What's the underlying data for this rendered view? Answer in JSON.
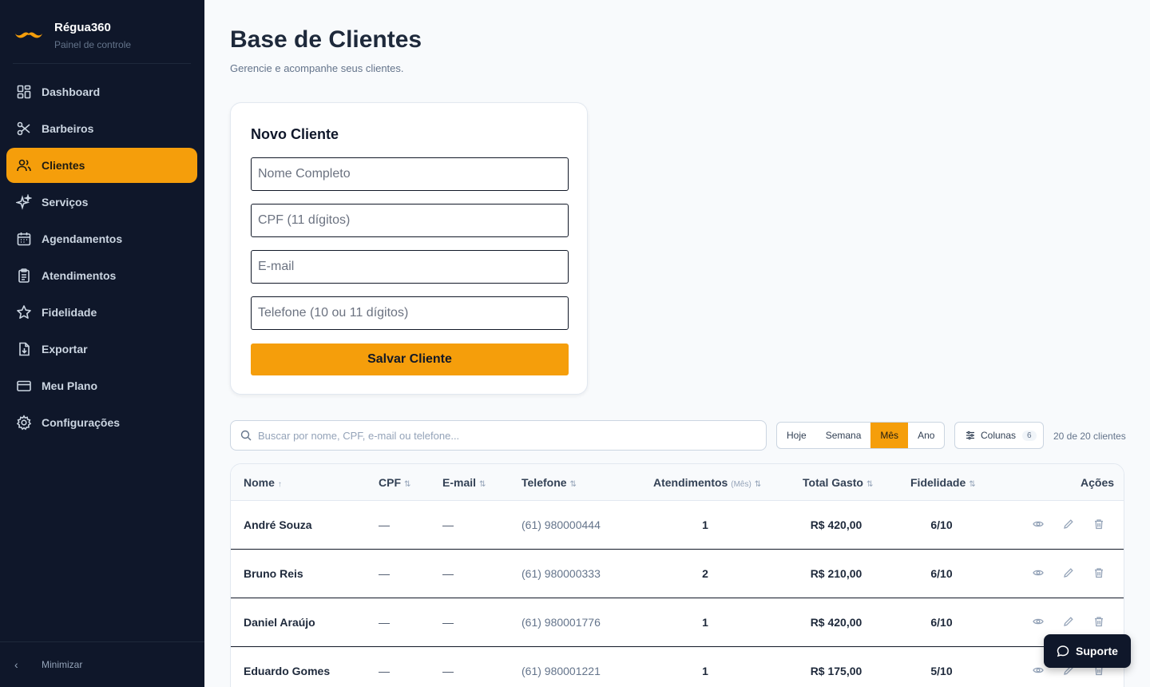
{
  "brand": {
    "name": "Régua360",
    "subtitle": "Painel de controle"
  },
  "sidebar": {
    "items": [
      {
        "label": "Dashboard",
        "icon": "grid-icon",
        "active": false
      },
      {
        "label": "Barbeiros",
        "icon": "scissors-icon",
        "active": false
      },
      {
        "label": "Clientes",
        "icon": "users-icon",
        "active": true
      },
      {
        "label": "Serviços",
        "icon": "sparkles-icon",
        "active": false
      },
      {
        "label": "Agendamentos",
        "icon": "calendar-icon",
        "active": false
      },
      {
        "label": "Atendimentos",
        "icon": "clipboard-icon",
        "active": false
      },
      {
        "label": "Fidelidade",
        "icon": "star-icon",
        "active": false
      },
      {
        "label": "Exportar",
        "icon": "file-download-icon",
        "active": false
      },
      {
        "label": "Meu Plano",
        "icon": "credit-card-icon",
        "active": false
      },
      {
        "label": "Configurações",
        "icon": "gear-icon",
        "active": false
      }
    ],
    "minimize_label": "Minimizar"
  },
  "page": {
    "title": "Base de Clientes",
    "subtitle": "Gerencie e acompanhe seus clientes."
  },
  "form": {
    "title": "Novo Cliente",
    "name_placeholder": "Nome Completo",
    "cpf_placeholder": "CPF (11 dígitos)",
    "email_placeholder": "E-mail",
    "phone_placeholder": "Telefone (10 ou 11 dígitos)",
    "save_label": "Salvar Cliente"
  },
  "toolbar": {
    "search_placeholder": "Buscar por nome, CPF, e-mail ou telefone...",
    "periods": [
      "Hoje",
      "Semana",
      "Mês",
      "Ano"
    ],
    "active_period": "Mês",
    "columns_label": "Colunas",
    "columns_count": "6",
    "count_text": "20 de 20 clientes"
  },
  "table": {
    "headers": {
      "name": "Nome",
      "name_sort": "↑",
      "cpf": "CPF",
      "email": "E-mail",
      "phone": "Telefone",
      "attendances": "Atendimentos",
      "attendances_sub": "(Mês)",
      "total": "Total Gasto",
      "loyalty": "Fidelidade",
      "actions": "Ações",
      "sort_symbol": "⇅"
    },
    "rows": [
      {
        "name": "André Souza",
        "cpf": "—",
        "email": "—",
        "phone": "(61) 980000444",
        "attendances": "1",
        "total": "R$ 420,00",
        "loyalty": "6/10"
      },
      {
        "name": "Bruno Reis",
        "cpf": "—",
        "email": "—",
        "phone": "(61) 980000333",
        "attendances": "2",
        "total": "R$ 210,00",
        "loyalty": "6/10"
      },
      {
        "name": "Daniel Araújo",
        "cpf": "—",
        "email": "—",
        "phone": "(61) 980001776",
        "attendances": "1",
        "total": "R$ 420,00",
        "loyalty": "6/10"
      },
      {
        "name": "Eduardo Gomes",
        "cpf": "—",
        "email": "—",
        "phone": "(61) 980001221",
        "attendances": "1",
        "total": "R$ 175,00",
        "loyalty": "5/10"
      }
    ]
  },
  "support": {
    "label": "Suporte"
  },
  "colors": {
    "accent": "#f59e0b",
    "sidebar_bg": "#0f172a",
    "page_bg": "#f8fafc"
  }
}
